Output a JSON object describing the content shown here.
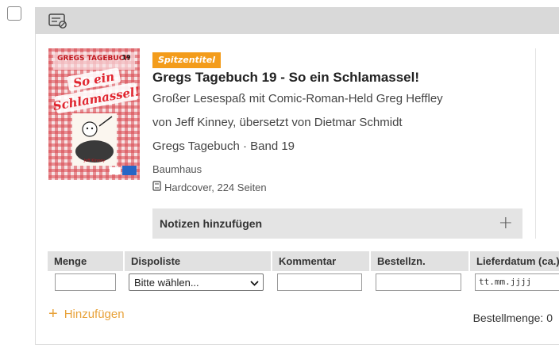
{
  "header": {
    "icon": "card-settings-icon"
  },
  "book": {
    "badge": "Spitzentitel",
    "title": "Gregs Tagebuch 19 - So ein Schlamassel!",
    "subtitle": "Großer Lesespaß mit Comic-Roman-Held Greg Heffley",
    "authors": "von Jeff Kinney, übersetzt von Dietmar Schmidt",
    "series": "Gregs Tagebuch · Band 19",
    "publisher": "Baumhaus",
    "format": "Hardcover, 224 Seiten",
    "format_icon": "book-icon",
    "cover": {
      "series_text": "GREGS TAGEBUCH",
      "number": "19",
      "title_line1": "So ein",
      "title_line2": "Schlamassel!",
      "author": "Jeff Kinney",
      "colors": {
        "check_red": "#d8464f",
        "title_red": "#e0252f"
      }
    }
  },
  "notes": {
    "label": "Notizen hinzufügen",
    "icon": "plus-icon"
  },
  "order_table": {
    "headers": [
      "Menge",
      "Dispoliste",
      "Kommentar",
      "Bestellzn.",
      "Lieferdatum (ca.)"
    ],
    "quantity_value": "",
    "dispoliste_selected": "Bitte wählen...",
    "comment_value": "",
    "order_sign_value": "",
    "date_placeholder": "tt.mm.jjjj"
  },
  "add_label": "Hinzufügen",
  "order_quantity": "Bestellmenge: 0",
  "colors": {
    "accent": "#f39c1b",
    "add_link": "#e8a23a",
    "bar_gray": "#d9d9d9"
  }
}
